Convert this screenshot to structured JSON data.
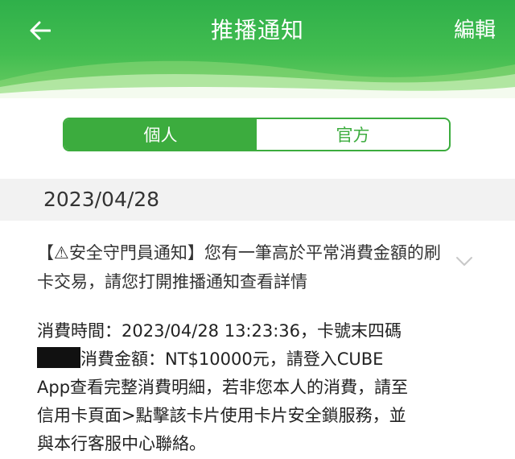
{
  "header": {
    "title": "推播通知",
    "edit_label": "編輯",
    "back_icon": "arrow-left-icon"
  },
  "tabs": [
    {
      "label": "個人",
      "active": true
    },
    {
      "label": "官方",
      "active": false
    }
  ],
  "date": "2023/04/28",
  "message": {
    "title": "【⚠安全守門員通知】您有一筆高於平常消費金額的刷卡交易，請您打開推播通知查看詳情",
    "body_part1": "消費時間：2023/04/28 13:23:36，卡號末四碼",
    "body_part2": "消費金額：NT$10000元，請登入CUBE App查看完整消費明細，若非您本人的消費，請至信用卡頁面>點擊該卡片使用卡片安全鎖服務，並與本行客服中心聯絡。"
  },
  "colors": {
    "brand_green": "#3cac3e",
    "header_green": "#2fb04a"
  }
}
